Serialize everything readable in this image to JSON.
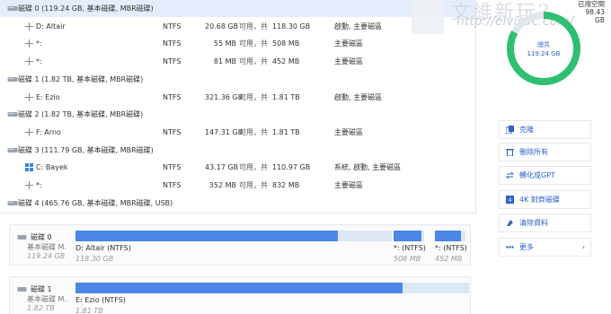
{
  "partitions": [
    {
      "kind": "disk",
      "name": "磁碟 0",
      "info": "(119.24 GB, 基本磁碟, MBR磁碟)",
      "selected": true
    },
    {
      "kind": "part",
      "name": "D: Altair",
      "fs": "NTFS",
      "used": "20.68 GB",
      "sep": "可用，共",
      "total": "118.30 GB",
      "type": "啟動, 主要磁區"
    },
    {
      "kind": "part",
      "name": "*:",
      "fs": "NTFS",
      "used": "55 MB",
      "sep": "可用，共",
      "total": "508 MB",
      "type": "主要磁區"
    },
    {
      "kind": "part",
      "name": "*:",
      "fs": "NTFS",
      "used": "81 MB",
      "sep": "可用，共",
      "total": "452 MB",
      "type": "主要磁區"
    },
    {
      "kind": "disk",
      "name": "磁碟 1",
      "info": "(1.82 TB, 基本磁碟, MBR磁碟)"
    },
    {
      "kind": "part",
      "name": "E: Ezio",
      "fs": "NTFS",
      "used": "321.36 GB",
      "sep": "可用，共",
      "total": "1.81 TB",
      "type": "啟動, 主要磁區"
    },
    {
      "kind": "disk",
      "name": "磁碟 2",
      "info": "(1.82 TB, 基本磁碟, MBR磁碟)"
    },
    {
      "kind": "part",
      "name": "F: Arno",
      "fs": "NTFS",
      "used": "147.31 GB",
      "sep": "可用，共",
      "total": "1.81 TB",
      "type": "主要磁區"
    },
    {
      "kind": "disk",
      "name": "磁碟 3",
      "info": "(111.79 GB, 基本磁碟, MBR磁碟)"
    },
    {
      "kind": "part",
      "name": "C: Bayek",
      "fs": "NTFS",
      "used": "43.17 GB",
      "sep": "可用，共",
      "total": "110.97 GB",
      "type": "系統, 啟動, 主要磁區",
      "sys": true
    },
    {
      "kind": "part",
      "name": "*:",
      "fs": "NTFS",
      "used": "352 MB",
      "sep": "可用，共",
      "total": "832 MB",
      "type": "主要磁區"
    },
    {
      "kind": "disk",
      "name": "磁碟 4",
      "info": "(465.76 GB, 基本磁碟, MBR磁碟, USB)"
    }
  ],
  "disk_map": [
    {
      "name": "磁碟 0",
      "type": "基本磁碟 M.",
      "size": "119.24 GB",
      "parts": [
        {
          "label": "D: Altair (NTFS)",
          "size": "118.30 GB",
          "fill": 0.83
        },
        {
          "label": "*: (NTFS)",
          "size": "508 MB",
          "fill": 0.9
        },
        {
          "label": "*: (NTFS)",
          "size": "452 MB",
          "fill": 0.85
        }
      ]
    },
    {
      "name": "磁碟 1",
      "type": "基本磁碟 M.",
      "size": "1.82 TB",
      "parts": [
        {
          "label": "E: Ezio (NTFS)",
          "size": "1.81 TB",
          "fill": 0.83
        }
      ]
    }
  ],
  "usage": {
    "free_label": "已用空間",
    "free_value": "98.43 GB",
    "total_label": "總共",
    "total_value": "119.24 GB",
    "used_fraction": 0.83
  },
  "watermark": {
    "brand": "文維新玩3",
    "url": "http://elvis3c.com/"
  },
  "actions": [
    {
      "label": "克隆",
      "icon": "clone-icon"
    },
    {
      "label": "刪除所有",
      "icon": "trash-icon"
    },
    {
      "label": "轉化成GPT",
      "icon": "convert-icon"
    },
    {
      "label": "4K 對齊磁碟",
      "icon": "align-icon"
    },
    {
      "label": "清除資料",
      "icon": "wipe-icon"
    },
    {
      "label": "更多",
      "icon": "more-icon",
      "chevron": "›"
    }
  ],
  "colors": {
    "accent": "#4a87e6",
    "ring": "#2fbf71",
    "selected": "#e3edfb",
    "link": "#2b63c6"
  }
}
